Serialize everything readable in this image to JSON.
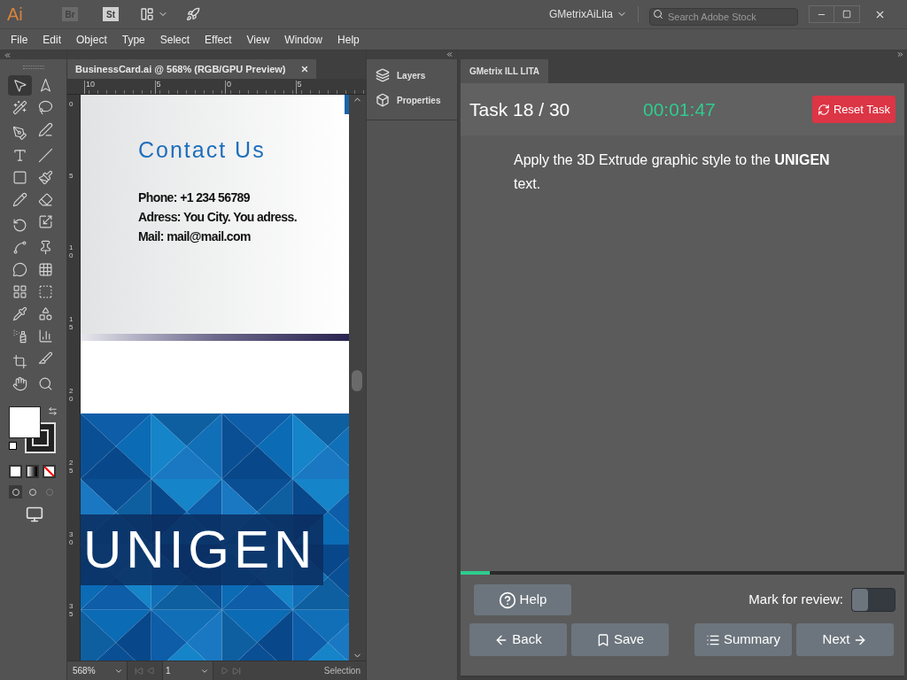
{
  "app_bar": {
    "logo": "Ai",
    "bridge": "Br",
    "stock": "St",
    "workspace": "GMetrixAiLita",
    "search": {
      "placeholder": "Search Adobe Stock"
    }
  },
  "menu": [
    "File",
    "Edit",
    "Object",
    "Type",
    "Select",
    "Effect",
    "View",
    "Window",
    "Help"
  ],
  "toolbar": {
    "tools": [
      {
        "selected": true
      },
      {
        "selected": false
      },
      {
        "selected": false
      },
      {
        "selected": false
      },
      {
        "selected": false
      },
      {
        "selected": false
      },
      {
        "selected": false
      },
      {
        "selected": false
      },
      {
        "selected": false
      },
      {
        "selected": false
      },
      {
        "selected": false
      },
      {
        "selected": false
      },
      {
        "selected": false
      },
      {
        "selected": false
      },
      {
        "selected": false
      },
      {
        "selected": false
      },
      {
        "selected": false
      },
      {
        "selected": false
      },
      {
        "selected": false
      },
      {
        "selected": false
      },
      {
        "selected": false
      },
      {
        "selected": false
      },
      {
        "selected": false
      },
      {
        "selected": false
      },
      {
        "selected": false
      },
      {
        "selected": false
      },
      {
        "selected": false
      },
      {
        "selected": false
      }
    ]
  },
  "document": {
    "tab": "BusinessCard.ai @ 568% (RGB/GPU Preview)",
    "ruler_h": [
      "10",
      "5",
      "0",
      "5"
    ],
    "ruler_v": [
      "0",
      "5",
      "10",
      "15",
      "20",
      "25",
      "30",
      "35"
    ],
    "card": {
      "heading": "Contact Us",
      "lines": [
        "Phone: +1 234 56789",
        "Adress: You City. You adress.",
        "Mail: mail@mail.com"
      ],
      "logo_text": "UNIGEN"
    },
    "status": {
      "zoom": "568%",
      "page": "1",
      "tool": "Selection"
    }
  },
  "dock": [
    {
      "kind": "layers",
      "label": "Layers"
    },
    {
      "kind": "properties",
      "label": "Properties"
    }
  ],
  "panel": {
    "tab": "GMetrix ILL LITA",
    "task": "Task 18 / 30",
    "timer": "00:01:47",
    "reset": "Reset Task",
    "instruction": "Apply the 3D Extrude graphic style to the **UNIGEN** text.",
    "progress": {
      "level": 0.065
    },
    "help": "Help",
    "review": {
      "label": "Mark for review:",
      "on": false
    },
    "buttons": [
      {
        "kind": "back",
        "label": "Back"
      },
      {
        "kind": "save",
        "label": "Save"
      },
      {
        "kind": "summary",
        "label": "Summary"
      },
      {
        "kind": "next",
        "label": "Next"
      }
    ]
  }
}
